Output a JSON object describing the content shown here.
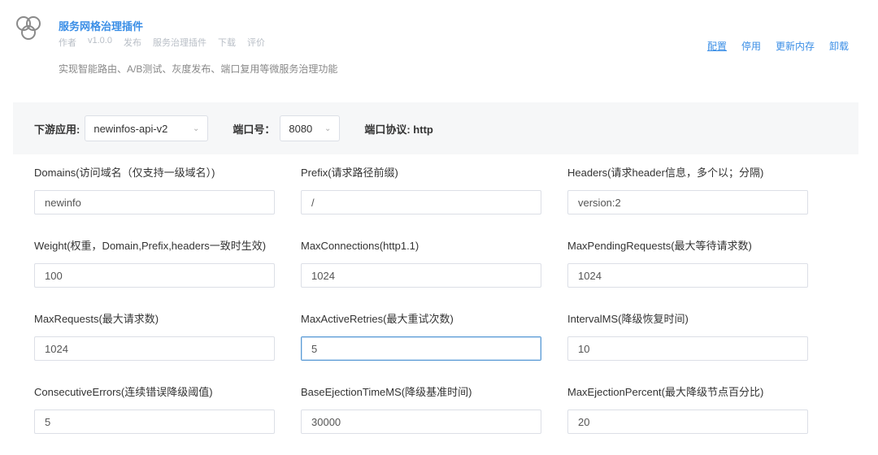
{
  "plugin": {
    "title": "服务网格治理插件",
    "meta": [
      "作者",
      "v1.0.0",
      "发布",
      "服务治理插件",
      "下载",
      "评价"
    ],
    "description": "实现智能路由、A/B测试、灰度发布、端口复用等微服务治理功能",
    "actions": [
      "配置",
      "停用",
      "更新内存",
      "卸载"
    ]
  },
  "config_bar": {
    "downstream_label": "下游应用:",
    "downstream_value": "newinfos-api-v2",
    "port_label": "端口号：",
    "port_value": "8080",
    "protocol_text": "端口协议: http"
  },
  "fields": [
    {
      "label": "Domains(访问域名（仅支持一级域名）)",
      "value": "newinfo"
    },
    {
      "label": "Prefix(请求路径前缀)",
      "value": "/"
    },
    {
      "label": "Headers(请求header信息，多个以；分隔)",
      "value": "version:2"
    },
    {
      "label": "Weight(权重，Domain,Prefix,headers一致时生效)",
      "value": "100"
    },
    {
      "label": "MaxConnections(http1.1)",
      "value": "1024"
    },
    {
      "label": "MaxPendingRequests(最大等待请求数)",
      "value": "1024"
    },
    {
      "label": "MaxRequests(最大请求数)",
      "value": "1024"
    },
    {
      "label": "MaxActiveRetries(最大重试次数)",
      "value": "5"
    },
    {
      "label": "IntervalMS(降级恢复时间)",
      "value": "10"
    },
    {
      "label": "ConsecutiveErrors(连续错误降级阈值)",
      "value": "5"
    },
    {
      "label": "BaseEjectionTimeMS(降级基准时间)",
      "value": "30000"
    },
    {
      "label": "MaxEjectionPercent(最大降级节点百分比)",
      "value": "20"
    }
  ]
}
